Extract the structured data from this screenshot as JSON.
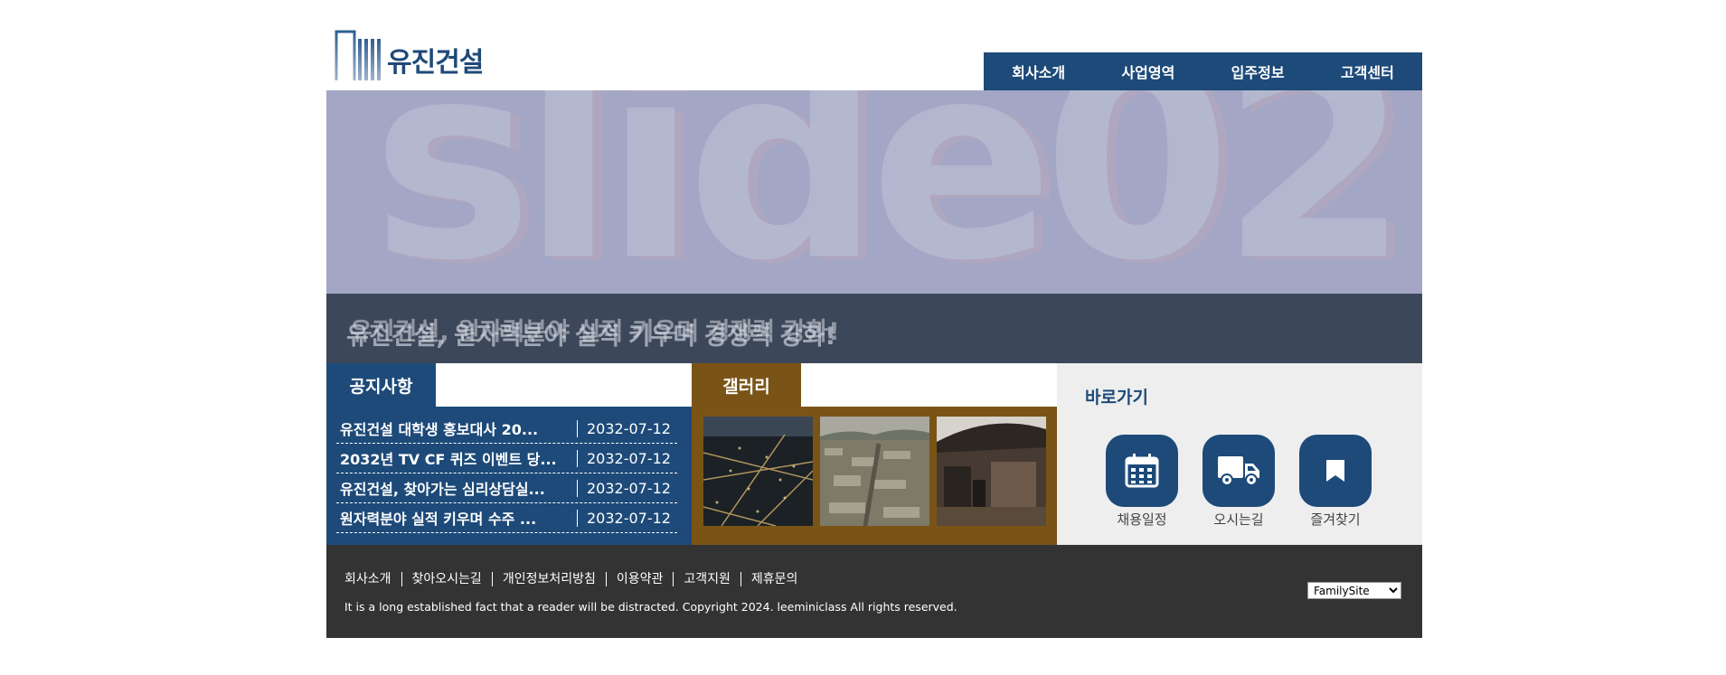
{
  "header": {
    "logo_text": "유진건설",
    "nav": [
      {
        "label": "회사소개"
      },
      {
        "label": "사업영역"
      },
      {
        "label": "입주정보"
      },
      {
        "label": "고객센터"
      }
    ]
  },
  "slider": {
    "slide_label": "slide02",
    "caption": "유진건설, 원자력분야 실적 키우며 경쟁력 강화!",
    "caption_overlay": "유진건설, 원자력분야 실적 키우며 경쟁력 강화!"
  },
  "notice": {
    "tab_label": "공지사항",
    "items": [
      {
        "title": "유진건설 대학생 홍보대사 20...",
        "date": "2032-07-12"
      },
      {
        "title": "2032년 TV CF 퀴즈 이벤트 당...",
        "date": "2032-07-12"
      },
      {
        "title": "유진건설, 찾아가는 심리상담실...",
        "date": "2032-07-12"
      },
      {
        "title": "원자력분야 실적 키우며 수주 ...",
        "date": "2032-07-12"
      }
    ]
  },
  "gallery": {
    "tab_label": "갤러리"
  },
  "quick": {
    "title": "바로가기",
    "items": [
      {
        "label": "채용일정",
        "icon": "calendar-icon"
      },
      {
        "label": "오시는길",
        "icon": "truck-icon"
      },
      {
        "label": "즐겨찾기",
        "icon": "bookmark-icon"
      }
    ]
  },
  "footer": {
    "links": [
      "회사소개",
      "찾아오시는길",
      "개인정보처리방침",
      "이용약관",
      "고객지원",
      "제휴문의"
    ],
    "copyright": "It is a long established fact that a reader will be distracted. Copyright 2024. leeminiclass All rights reserved.",
    "family_site": "FamilySite"
  },
  "colors": {
    "brand": "#1d4a79",
    "gallery": "#7a5417",
    "footer": "#333333"
  }
}
